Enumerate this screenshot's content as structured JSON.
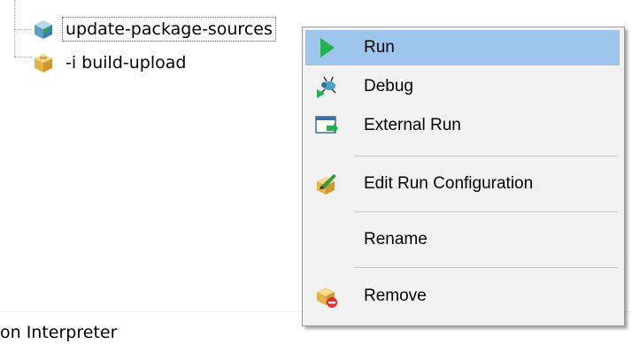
{
  "tree": {
    "items": [
      {
        "label": "update-package-sources",
        "icon": "package-blue-icon",
        "selected": true
      },
      {
        "label": "-i build-upload",
        "icon": "package-yellow-icon",
        "selected": false
      }
    ]
  },
  "status": {
    "text": "on Interpreter"
  },
  "context_menu": {
    "items": [
      {
        "label": "Run",
        "icon": "run-play-icon",
        "highlighted": true
      },
      {
        "label": "Debug",
        "icon": "debug-bug-icon"
      },
      {
        "label": "External Run",
        "icon": "external-run-icon"
      },
      {
        "label": "Edit Run Configuration",
        "icon": "edit-config-icon"
      },
      {
        "label": "Rename",
        "icon": null
      },
      {
        "label": "Remove",
        "icon": "remove-package-icon"
      }
    ]
  },
  "colors": {
    "highlight": "#9ec6ec",
    "menu_bg": "#f2f2f2",
    "run_green": "#22b14c"
  }
}
